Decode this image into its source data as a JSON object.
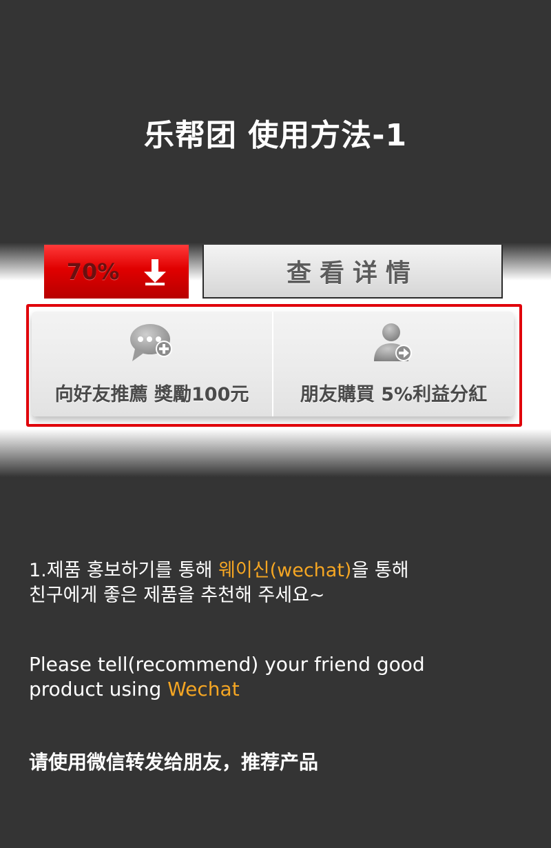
{
  "title": "乐帮团 使用方法-1",
  "deal": {
    "discount": "70%",
    "detail_label": "查看详情"
  },
  "actions": [
    {
      "label": "向好友推薦 獎勵100元",
      "icon": "chat-add-icon"
    },
    {
      "label": "朋友購買 5%利益分紅",
      "icon": "user-share-icon"
    }
  ],
  "instructions": {
    "ko_line1_a": "1.제품 홍보하기를 통해 ",
    "ko_line1_accent": "웨이신(wechat)",
    "ko_line1_b": "을 통해",
    "ko_line2": "친구에게 좋은 제품을 추천해 주세요~",
    "en_line1": "Please tell(recommend) your friend good",
    "en_line2_a": "product using ",
    "en_line2_accent": "Wechat",
    "zh": "请使用微信转发给朋友，推荐产品"
  },
  "colors": {
    "background": "#343434",
    "accent": "#f5a623",
    "highlight": "#e0000a",
    "discount_red": "#e00000"
  }
}
